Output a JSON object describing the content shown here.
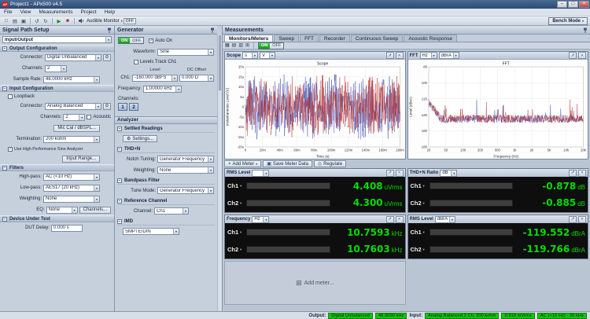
{
  "window": {
    "title": "Project1 - APx500 v4.5"
  },
  "menu": [
    "File",
    "View",
    "Measurements",
    "Project",
    "Help"
  ],
  "toolbar": {
    "icons": [
      {
        "name": "new-project-icon",
        "glyph": "□"
      },
      {
        "name": "open-project-icon",
        "glyph": "▤"
      },
      {
        "name": "save-project-icon",
        "glyph": "▣"
      },
      {
        "name": "undo-icon",
        "glyph": "↺"
      },
      {
        "name": "redo-icon",
        "glyph": "↻"
      },
      {
        "name": "run-sequence-icon",
        "glyph": "▶"
      },
      {
        "name": "stop-icon",
        "glyph": "■"
      }
    ],
    "audible_monitor_label": "Audible Monitor",
    "monitor_state": "OFF",
    "bench_mode_label": "Bench Mode"
  },
  "signal_path": {
    "title": "Signal Path Setup",
    "selector": "Input/Output",
    "output": {
      "title": "Output Configuration",
      "connector_label": "Connector:",
      "connector": "Digital Unbalanced",
      "channels_label": "Channels:",
      "channels": "2",
      "samplerate_label": "Sample Rate:",
      "samplerate": "48.0000 kHz"
    },
    "input": {
      "title": "Input Configuration",
      "loopback_label": "Loopback",
      "connector_label": "Connector:",
      "connector": "Analog Balanced",
      "channels_label": "Channels:",
      "channels": "2",
      "acoustic_label": "Acoustic",
      "mic_cal_button": "Mic Cal / dBSPL...",
      "termination_label": "Termination:",
      "termination": "200 kohm",
      "hps_label": "Use High Performance Sine Analyzer",
      "input_range_button": "Input Range..."
    },
    "filters": {
      "title": "Filters",
      "highpass_label": "High-pass:",
      "highpass": "AC (<10 Hz)",
      "lowpass_label": "Low-pass:",
      "lowpass": "AES17 (20 kHz)",
      "weighting_label": "Weighting:",
      "weighting": "None",
      "eq_label": "EQ:",
      "eq": "None",
      "channels_button": "Channels..."
    },
    "dut": {
      "title": "Device Under Test",
      "delay_label": "DUT Delay:",
      "delay": "0.000 s"
    }
  },
  "generator": {
    "title": "Generator",
    "on_label": "ON",
    "off_label": "OFF",
    "auto_on_label": "Auto On",
    "waveform_label": "Waveform:",
    "waveform": "Sine",
    "levels_track_label": "Levels Track Ch1",
    "level_col": "Level",
    "dc_col": "DC Offset",
    "ch1_label": "Ch1:",
    "ch1_level": "-160.000 dBFS",
    "ch1_dc": "0.000 D",
    "frequency_label": "Frequency:",
    "frequency": "1.00000 kHz",
    "channels_label": "Channels:",
    "ch_button_1": "1",
    "ch_button_2": "2"
  },
  "analyzer": {
    "title": "Analyzer",
    "settled": {
      "title": "Settled Readings",
      "settings_button": "Settings..."
    },
    "thdn": {
      "title": "THD+N",
      "notch_label": "Notch Tuning:",
      "notch": "Generator Frequency",
      "weighting_label": "Weighting:",
      "weighting": "None"
    },
    "bandpass": {
      "title": "Bandpass Filter",
      "tune_label": "Tune Mode:",
      "tune": "Generator Frequency"
    },
    "refch": {
      "title": "Reference Channel",
      "channel_label": "Channel:",
      "channel": "Ch1"
    },
    "imd": {
      "title": "IMD",
      "mode": "SMPTE/DIN"
    }
  },
  "measurements": {
    "title": "Measurements",
    "tabs": [
      "Monitors/Meters",
      "Sweep",
      "FFT",
      "Recorder",
      "Continuous Sweep",
      "Acoustic Response"
    ],
    "active_tab": "Monitors/Meters",
    "layout_icons": [
      {
        "name": "layout-grid-icon",
        "glyph": "▦"
      },
      {
        "name": "layout-rows-icon",
        "glyph": "▤"
      },
      {
        "name": "layout-cols-icon",
        "glyph": "▥"
      },
      {
        "name": "add-monitor-icon",
        "glyph": "⊞"
      }
    ],
    "generator_toggle_on": "ON",
    "generator_toggle_off": "OFF",
    "scope_panel": {
      "title": "Scope",
      "x_unit": "s",
      "y_unit": "V"
    },
    "fft_panel": {
      "title": "FFT",
      "x_unit": "Hz",
      "y_unit": "dBrA"
    },
    "meter_toolbar": {
      "add_label": "Add Meter",
      "save_label": "Save Meter Data",
      "regulate_label": "Regulate"
    },
    "meters": [
      {
        "title": "RMS Level",
        "unit_combo": "",
        "channels": [
          {
            "name": "Ch1",
            "value": "4.408",
            "unit": "uVrms",
            "fill": 0.57
          },
          {
            "name": "Ch2",
            "value": "4.300",
            "unit": "uVrms",
            "fill": 0.55
          }
        ]
      },
      {
        "title": "THD+N Ratio",
        "unit_combo": "dB",
        "channels": [
          {
            "name": "Ch1",
            "value": "-0.878",
            "unit": "dB",
            "fill": 0.96
          },
          {
            "name": "Ch2",
            "value": "-0.885",
            "unit": "dB",
            "fill": 0.96
          }
        ]
      },
      {
        "title": "Frequency",
        "unit_combo": "Hz",
        "channels": [
          {
            "name": "Ch1",
            "value": "10.7593",
            "unit": "kHz",
            "fill": 1
          },
          {
            "name": "Ch2",
            "value": "10.7603",
            "unit": "kHz",
            "fill": 1
          }
        ]
      },
      {
        "title": "RMS Level",
        "unit_combo": "dBrA",
        "channels": [
          {
            "name": "Ch1",
            "value": "-119.552",
            "unit": "dBrA",
            "fill": 0.28
          },
          {
            "name": "Ch2",
            "value": "-119.766",
            "unit": "dBrA",
            "fill": 0.27
          }
        ]
      }
    ],
    "add_meter_label": "Add meter..."
  },
  "statusbar": {
    "output_label": "Output:",
    "output_chips": [
      "Digital Unbalanced",
      "48.0000 kHz"
    ],
    "input_label": "Input:",
    "input_chips": [
      "Analog Balanced 2 Ch, 200 kohm",
      "0.910 mVrms",
      "AC (<10 Hz) - 20 kHz"
    ]
  },
  "chart_data": [
    {
      "type": "line",
      "mode": "noise",
      "seed": 42,
      "points": 500,
      "amp": 0.82,
      "title": "Scope",
      "xlabel": "Time (s)",
      "ylabel": "Instantaneous Level (V)",
      "x_ticks": [
        "0",
        "20m",
        "40m",
        "60m",
        "80m",
        "100m",
        "120m",
        "140m",
        "160m",
        "180m"
      ],
      "y_ticks": [
        "20u",
        "15u",
        "10u",
        "5u",
        "0",
        "-5u",
        "-10u",
        "-15u",
        "-20u"
      ],
      "x_range": [
        "0 s",
        "180 ms"
      ],
      "y_range": [
        "-20 uV",
        "20 uV"
      ],
      "grid": true,
      "series": [
        {
          "name": "Ch1",
          "color": "#3a49b0",
          "description": "broadband noise, approx +/-15 uV instantaneous"
        },
        {
          "name": "Ch2",
          "color": "#b02a2a",
          "description": "broadband noise, approx +/-15 uV instantaneous"
        }
      ]
    },
    {
      "type": "line",
      "mode": "floor",
      "seed": 7,
      "points": 480,
      "baseline": 0.65,
      "jitter": 0.1,
      "spike": 0.2,
      "title": "FFT",
      "xlabel": "Frequency (Hz)",
      "ylabel": "Level (dBrA)",
      "x_ticks": [
        "20",
        "50",
        "100",
        "200",
        "500",
        "1k",
        "2k",
        "5k",
        "10k",
        "20k"
      ],
      "y_ticks": [
        "-80",
        "-100",
        "-120",
        "-140",
        "-160",
        "-180"
      ],
      "x_range": [
        "20 Hz",
        "20 kHz"
      ],
      "y_range": [
        "-180 dBrA",
        "-80 dBrA"
      ],
      "grid": true,
      "series": [
        {
          "name": "Ch1",
          "color": "#3a49b0",
          "description": "noise floor near -145 dBrA with sparse spikes"
        },
        {
          "name": "Ch2",
          "color": "#b02a2a",
          "description": "noise floor near -145 dBrA with sparse spikes"
        }
      ]
    }
  ]
}
